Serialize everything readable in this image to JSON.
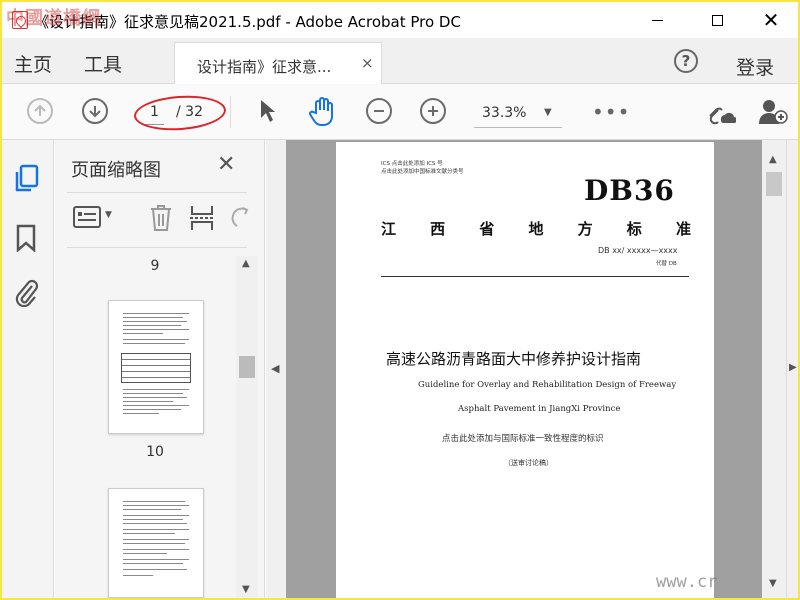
{
  "window": {
    "title": "《设计指南》征求意见稿2021.5.pdf - Adobe Acrobat Pro DC",
    "watermark": "中國道橋網",
    "minimize": "",
    "maximize": "",
    "close": "✕"
  },
  "menu": {
    "home": "主页",
    "tools": "工具",
    "tab_label": "设计指南》征求意...",
    "tab_close": "×",
    "help": "?",
    "login": "登录"
  },
  "toolbar": {
    "current_page": "1",
    "total_pages": "/ 32",
    "zoom": "33.3%",
    "zoom_caret": "▼",
    "more": "•••",
    "highlight_color": "#d9262c",
    "accent_color": "#1473e6"
  },
  "panel": {
    "title": "页面缩略图",
    "close": "✕",
    "thumbnails": [
      {
        "label": "9"
      },
      {
        "label": "10"
      }
    ]
  },
  "document": {
    "ics_line1": "ICS 点击此处添加 ICS 号",
    "ics_line2": "点击此处添加中国标准文献分类号",
    "standard_code": "DB36",
    "province_chars": [
      "江",
      "西",
      "省",
      "地",
      "方",
      "标",
      "准"
    ],
    "db_number": "DB xx/ xxxxx—xxxx",
    "replace": "代替 DB",
    "title_zh": "高速公路沥青路面大中修养护设计指南",
    "title_en_line1": "Guideline for Overlay and Rehabilitation Design of Freeway",
    "title_en_line2": "Asphalt Pavement in JiangXi Province",
    "consistency_note": "点击此处添加与国际标准一致性程度的标识",
    "draft": "（送审讨论稿）"
  },
  "corner_watermark": "www.cr"
}
